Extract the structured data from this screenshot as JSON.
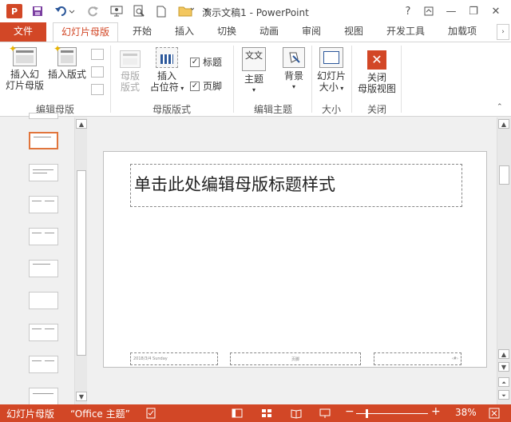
{
  "window": {
    "title": "演示文稿1 - PowerPoint",
    "app_logo": "P",
    "controls": {
      "help": "?",
      "minimize": "—",
      "restore": "❐",
      "close": "✕"
    }
  },
  "tabs": [
    {
      "label": "文件"
    },
    {
      "label": "幻灯片母版"
    },
    {
      "label": "开始"
    },
    {
      "label": "插入"
    },
    {
      "label": "切换"
    },
    {
      "label": "动画"
    },
    {
      "label": "审阅"
    },
    {
      "label": "视图"
    },
    {
      "label": "开发工具"
    },
    {
      "label": "加载项"
    }
  ],
  "ribbon": {
    "edit_master": {
      "label": "编辑母版",
      "insert_slide_master": [
        "插入幻",
        "灯片母版"
      ],
      "insert_layout": "插入版式"
    },
    "master_layout": {
      "label": "母版版式",
      "master_layout_btn": [
        "母版",
        "版式"
      ],
      "insert_placeholder": [
        "插入",
        "占位符"
      ],
      "title_check": "标题",
      "footer_check": "页脚"
    },
    "edit_theme": {
      "label": "编辑主题",
      "theme": "主题",
      "background": "背景",
      "theme_icon_text": "文文"
    },
    "size": {
      "label": "大小",
      "slide_size": [
        "幻灯片",
        "大小"
      ]
    },
    "close": {
      "label": "关闭",
      "close_master_view": [
        "关闭",
        "母版视图"
      ]
    }
  },
  "slide": {
    "title_placeholder": "单击此处编辑母版标题样式",
    "footer_date": "2018/3/4 Sunday",
    "footer_text": "页脚",
    "footer_num": "‹#›"
  },
  "status": {
    "view": "幻灯片母版",
    "theme": "“Office 主题”",
    "zoom": "38%"
  },
  "colors": {
    "accent": "#d24726"
  }
}
